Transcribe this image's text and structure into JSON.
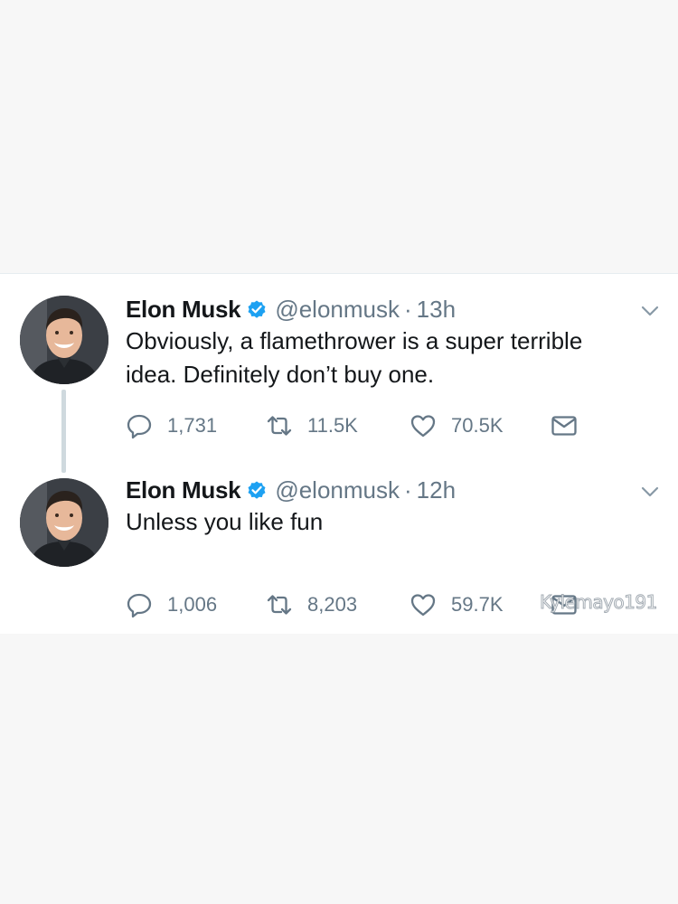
{
  "tweets": [
    {
      "name": "Elon Musk",
      "handle": "@elonmusk",
      "separator": "·",
      "time": "13h",
      "text": "Obviously, a flamethrower is a super terrible\nidea. Definitely don’t buy one.",
      "replies": "1,731",
      "retweets": "11.5K",
      "likes": "70.5K"
    },
    {
      "name": "Elon Musk",
      "handle": "@elonmusk",
      "separator": "·",
      "time": "12h",
      "text": "Unless you like fun",
      "replies": "1,006",
      "retweets": "8,203",
      "likes": "59.7K"
    }
  ],
  "watermark": "Kylemayo191",
  "icons": {
    "verified": "verified-badge-icon",
    "chevron": "chevron-down-icon",
    "reply": "reply-bubble-icon",
    "retweet": "retweet-icon",
    "like": "heart-icon",
    "dm": "envelope-icon"
  },
  "colors": {
    "page_background": "#f7f7f7",
    "card_background": "#ffffff",
    "text_primary": "#14171a",
    "text_secondary": "#657786",
    "verified_blue": "#1da1f2",
    "thread_line": "#cfd9de"
  }
}
